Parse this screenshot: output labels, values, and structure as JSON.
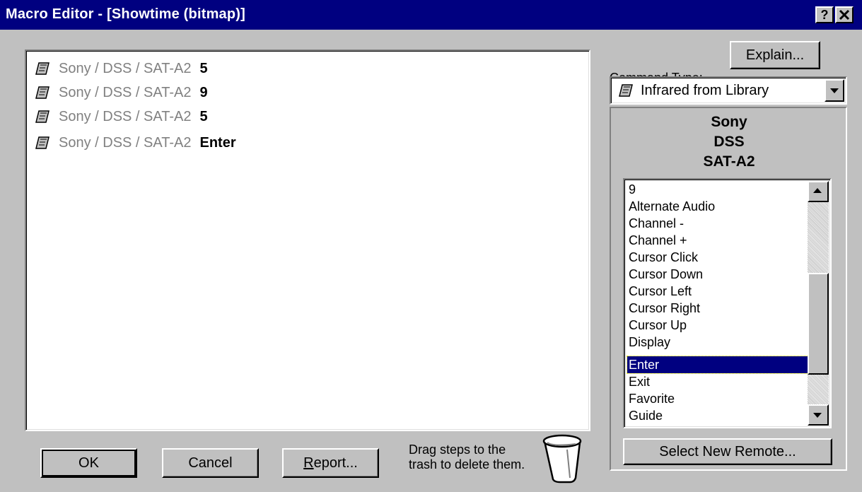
{
  "window": {
    "title": "Macro Editor - [Showtime (bitmap)]",
    "help_label": "?",
    "close_label": "✕"
  },
  "steps": [
    {
      "icon": "infrared-remote-icon",
      "device": "Sony / DSS / SAT-A2",
      "command": "5"
    },
    {
      "icon": "infrared-remote-icon",
      "device": "Sony / DSS / SAT-A2",
      "command": "9"
    },
    {
      "icon": "infrared-remote-icon",
      "device": "Sony / DSS / SAT-A2",
      "command": "5"
    },
    {
      "icon": "infrared-remote-icon",
      "device": "Sony / DSS / SAT-A2",
      "command": "Enter"
    }
  ],
  "buttons": {
    "ok": "OK",
    "cancel": "Cancel",
    "report_prefix": "R",
    "report_rest": "eport...",
    "explain": "Explain...",
    "select_remote": "Select New Remote..."
  },
  "hint": {
    "line1": "Drag steps to the",
    "line2": "trash to delete them."
  },
  "command_type": {
    "label_prefix": "Command ",
    "label_accel": "T",
    "label_rest": "ype:",
    "selected": "Infrared from Library",
    "icon": "infrared-remote-icon"
  },
  "remote": {
    "brand": "Sony",
    "device": "DSS",
    "model": "SAT-A2"
  },
  "commands": {
    "items": [
      "9",
      "Alternate Audio",
      "Channel -",
      "Channel +",
      "Cursor Click",
      "Cursor Down",
      "Cursor Left",
      "Cursor Right",
      "Cursor Up",
      "Display",
      "Enter",
      "Exit",
      "Favorite",
      "Guide"
    ],
    "selected": "Enter"
  },
  "colors": {
    "titlebar": "#000080",
    "face": "#c0c0c0",
    "selection": "#000080"
  }
}
